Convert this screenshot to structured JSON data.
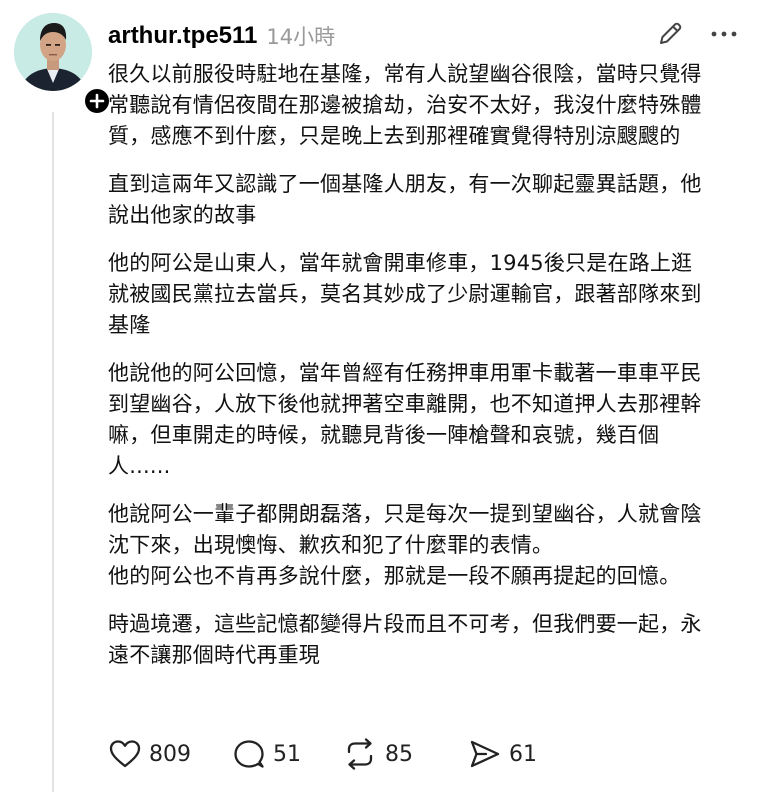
{
  "post": {
    "username": "arthur.tpe511",
    "timestamp": "14小時",
    "paragraphs": [
      "很久以前服役時駐地在基隆，常有人說望幽谷很陰，當時只覺得\n常聽說有情侶夜間在那邊被搶劫，治安不太好，我沒什麼特殊體\n質，感應不到什麼，只是晚上去到那裡確實覺得特別涼颼颼的",
      "直到這兩年又認識了一個基隆人朋友，有一次聊起靈異話題，他\n說出他家的故事",
      "他的阿公是山東人，當年就會開車修車，1945後只是在路上逛\n就被國民黨拉去當兵，莫名其妙成了少尉運輸官，跟著部隊來到\n基隆",
      "他說他的阿公回憶，當年曾經有任務押車用軍卡載著一車車平民\n到望幽谷，人放下後他就押著空車離開，也不知道押人去那裡幹\n嘛，但車開走的時候，就聽見背後一陣槍聲和哀號，幾百個\n人......",
      "他說阿公一輩子都開朗磊落，只是每次一提到望幽谷，人就會陰\n沈下來，出現懊悔、歉疚和犯了什麼罪的表情。\n他的阿公也不肯再多說什麼，那就是一段不願再提起的回憶。",
      "時過境遷，這些記憶都變得片段而且不可考，但我們要一起，永\n遠不讓那個時代再重現"
    ]
  },
  "actions": {
    "likes": "809",
    "replies": "51",
    "reposts": "85",
    "shares": "61"
  },
  "icons": {
    "avatar": "user-avatar-photo",
    "follow": "plus-icon",
    "edit": "pencil-icon",
    "more": "more-dots-icon",
    "like": "heart-icon",
    "reply": "comment-bubble-icon",
    "repost": "repost-arrows-icon",
    "share": "send-icon"
  },
  "colors": {
    "avatar_bg": "#c9ebe6",
    "timestamp": "#9a9a9a",
    "text": "#111111"
  }
}
